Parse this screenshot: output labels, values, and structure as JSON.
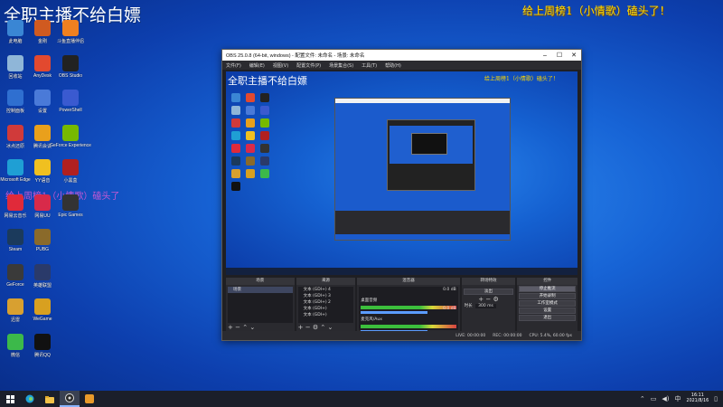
{
  "overlay": {
    "title": "全职主播不给白嫖",
    "right_text": "给上周榜1（小情歌）磕头了！",
    "left_text": "给上周榜1（小情歌）磕头了"
  },
  "desktop": {
    "col1": [
      {
        "label": "此电脑",
        "icon": "computer-icon",
        "color": "#3a86d4"
      },
      {
        "label": "回收站",
        "icon": "recycle-bin-icon",
        "color": "#8fb6d8"
      },
      {
        "label": "控制面板",
        "icon": "control-panel-icon",
        "color": "#2f6fd0"
      },
      {
        "label": "冰点还原",
        "icon": "app-icon",
        "color": "#d03a3a"
      },
      {
        "label": "Microsoft Edge",
        "icon": "edge-icon",
        "color": "#1f9fd4"
      },
      {
        "label": "网易云音乐",
        "icon": "music-icon",
        "color": "#e02a3a"
      },
      {
        "label": "Steam",
        "icon": "steam-icon",
        "color": "#1b3a5c"
      },
      {
        "label": "GeForce",
        "icon": "geforce-icon",
        "color": "#3a3a3a"
      },
      {
        "label": "迅雷",
        "icon": "thunder-icon",
        "color": "#d8a030"
      },
      {
        "label": "微信",
        "icon": "wechat-icon",
        "color": "#3cb94a"
      }
    ],
    "col2": [
      {
        "label": "金刚",
        "icon": "app-icon",
        "color": "#d05a20"
      },
      {
        "label": "AnyDesk",
        "icon": "anydesk-icon",
        "color": "#e2492f"
      },
      {
        "label": "设置",
        "icon": "settings-icon",
        "color": "#4a7ad8"
      },
      {
        "label": "腾讯会议",
        "icon": "meeting-icon",
        "color": "#e9a01c"
      },
      {
        "label": "YY语音",
        "icon": "yy-icon",
        "color": "#f0c020"
      },
      {
        "label": "网易UU",
        "icon": "uu-icon",
        "color": "#d82a4a"
      },
      {
        "label": "PUBG",
        "icon": "pubg-icon",
        "color": "#8a6a2a"
      },
      {
        "label": "英雄联盟",
        "icon": "lol-icon",
        "color": "#2a3a6a"
      },
      {
        "label": "WeGame",
        "icon": "wegame-icon",
        "color": "#d8a020"
      },
      {
        "label": "腾讯QQ",
        "icon": "qq-icon",
        "color": "#111"
      }
    ],
    "col3": [
      {
        "label": "斗鱼直播伴侣",
        "icon": "app-icon",
        "color": "#f08020"
      },
      {
        "label": "OBS Studio",
        "icon": "obs-icon",
        "color": "#222"
      },
      {
        "label": "PowerShell",
        "icon": "powershell-icon",
        "color": "#3a5ad0"
      },
      {
        "label": "GeForce Experience",
        "icon": "geforce-icon",
        "color": "#76b900"
      },
      {
        "label": "小黑盒",
        "icon": "app-icon",
        "color": "#b02020"
      },
      {
        "label": "Epic Games",
        "icon": "epic-icon",
        "color": "#333"
      }
    ]
  },
  "obs": {
    "title": "OBS 25.0.8 (64-bit, windows) - 配置文件: 未命名 - 场景: 未命名",
    "menu": [
      "文件(F)",
      "编辑(E)",
      "视图(V)",
      "配置文件(P)",
      "场景集合(S)",
      "工具(T)",
      "帮助(H)"
    ],
    "preview_title": "全职主播不给白嫖",
    "preview_right": "给上周榜1（小情歌）磕头了！",
    "docks": {
      "scenes": {
        "title": "场景",
        "items": [
          "场景"
        ]
      },
      "sources": {
        "title": "来源",
        "items": [
          "文本 (GDI+) 4",
          "文本 (GDI+) 3",
          "文本 (GDI+) 2",
          "文本 (GDI+)",
          "文本 (GDI+)"
        ]
      },
      "mixer": {
        "title": "混音器",
        "rows": [
          {
            "label": "桌面音频",
            "db": "0.0 dB"
          },
          {
            "label": "麦克风/Aux",
            "db": "0.0 dB"
          }
        ]
      },
      "transitions": {
        "title": "转场特效",
        "type": "淡出",
        "duration_label": "时长",
        "duration": "300 ms"
      },
      "controls": {
        "title": "控件",
        "buttons": [
          "停止推流",
          "开始录制",
          "工作室模式",
          "设置",
          "退出"
        ]
      }
    },
    "status": {
      "live": "LIVE: 00:00:00",
      "rec": "REC: 00:00:00",
      "cpu": "CPU: 5.4%, 60.00 fps"
    }
  },
  "taskbar": {
    "time": "16:11",
    "date": "2021/8/16",
    "lang": "中"
  }
}
